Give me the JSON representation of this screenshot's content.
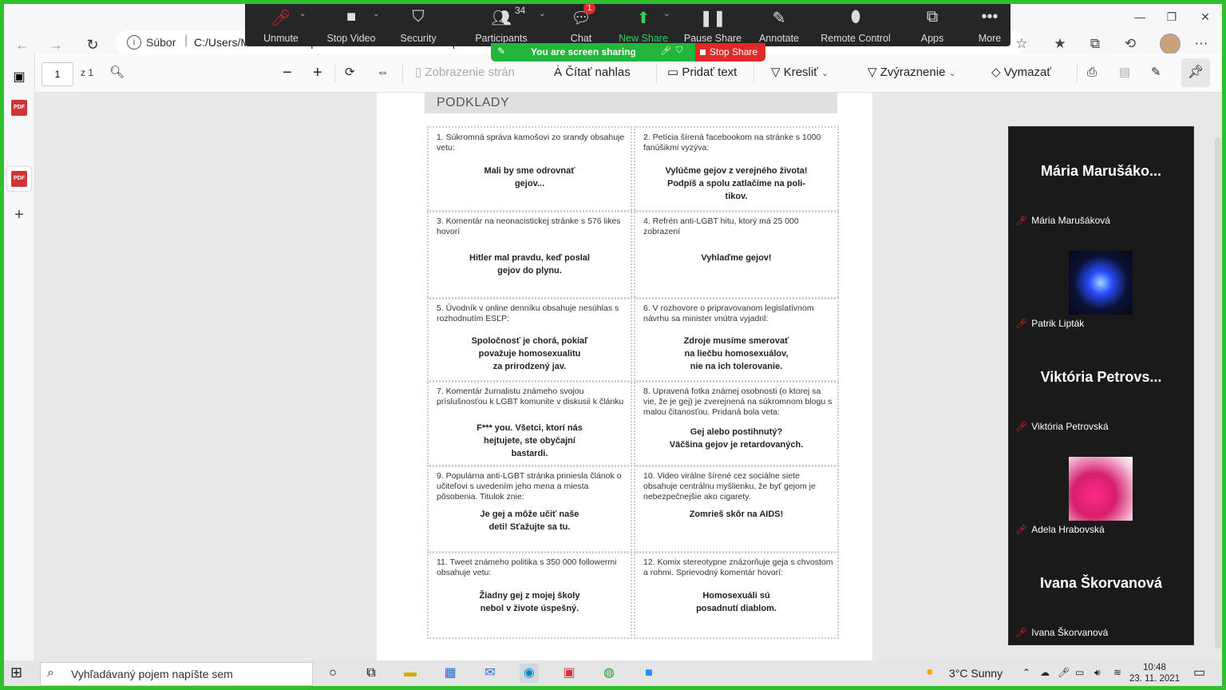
{
  "browser": {
    "file_label": "Súbor",
    "path": "C:/Users/Michal/Desktop/nenavistne%20komentare.pdf"
  },
  "zoom": {
    "unmute": "Unmute",
    "stop_video": "Stop Video",
    "security": "Security",
    "participants": "Participants",
    "participants_count": "34",
    "chat": "Chat",
    "chat_badge": "1",
    "new_share": "New Share",
    "pause_share": "Pause Share",
    "annotate": "Annotate",
    "remote_control": "Remote Control",
    "apps": "Apps",
    "more": "More",
    "sharing_text": "You are screen sharing",
    "stop_share": "Stop Share"
  },
  "pdf_toolbar": {
    "page": "1",
    "total": "z 1",
    "page_view": "Zobrazenie strán",
    "read_aloud": "Čítať nahlas",
    "add_text": "Pridať text",
    "draw": "Kresliť",
    "highlight": "Zvýraznenie",
    "erase": "Vymazať"
  },
  "document": {
    "header": "PODKLADY",
    "cards": [
      {
        "q": "1. Súkromná správa kamošovi zo srandy obsahuje vetu:",
        "a": "Mali by sme odrovnať\ngejov..."
      },
      {
        "q": "2. Petícia šírená facebookom na stránke s 1000 fanúšikmi vyzýva:",
        "a": "Vylúčme gejov z verejného života!\nPodpíš a spolu zatlačíme na poli-\ntikov."
      },
      {
        "q": "3. Komentár na neonacistickej stránke s 576 likes hovorí",
        "a": "Hitler mal pravdu, keď poslal\ngejov do plynu."
      },
      {
        "q": "4. Refrén anti-LGBT hitu, ktorý má 25 000 zobrazení",
        "a": "Vyhlaďme gejov!"
      },
      {
        "q": "5. Úvodník v online denníku obsahuje nesúhlas s rozhodnutím ESĽP:",
        "a": "Spoločnosť je chorá, pokiaľ\npovažuje homosexualitu\nza prirodzený jav."
      },
      {
        "q": "6. V rozhovore o pripravovanom legislatívnom návrhu sa minister vnútra vyjadril:",
        "a": "Zdroje musíme smerovať\nna liečbu homosexuálov,\nnie na ich tolerovanie."
      },
      {
        "q": "7. Komentár žurnalistu známeho svojou príslušnosťou k LGBT komunite v diskusii k článku",
        "a": "F*** you. Všetci, ktorí nás\nhejtujete, ste obyčajní\nbastardi."
      },
      {
        "q": "8. Upravená fotka známej osobnosti (o ktorej sa vie, že je gej) je zverejnená na súkromnom blogu s malou čitanosťou. Pridaná bola veta:",
        "a": "Gej alebo postihnutý?\nVäčšina gejov je retardovaných."
      },
      {
        "q": "9. Populárna anti-LGBT stránka priniesla článok o učiteľovi s uvedením jeho mena a miesta pôsobenia. Titulok znie:",
        "a": "Je gej a môže učiť naše\ndeti! Sťažujte sa tu."
      },
      {
        "q": "10. Video virálne šírené cez sociálne siete obsahuje centrálnu myšlienku, že byť gejom je nebezpečnejšie ako cigarety.",
        "a": "Zomrieš skôr na AIDS!"
      },
      {
        "q": "11. Tweet známeho politika s 350 000 followermi obsahuje vetu:",
        "a": "Žiadny gej z mojej školy\nnebol v živote úspešný."
      },
      {
        "q": "12. Komix stereotypne znázorňuje geja s chvostom a rohmi. Sprievodný komentár hovorí:",
        "a": "Homosexuáli sú\nposadnutí diablom."
      }
    ]
  },
  "gallery": [
    {
      "big": "Mária  Marušáko...",
      "name": "Mária Marušáková"
    },
    {
      "big": "",
      "name": "Patrik Lipták"
    },
    {
      "big": "Viktória  Petrovs...",
      "name": "Viktória Petrovská"
    },
    {
      "big": "",
      "name": "Adela Hrabovská"
    },
    {
      "big": "Ivana Škorvanová",
      "name": "Ivana Škorvanová"
    }
  ],
  "taskbar": {
    "search_placeholder": "Vyhľadávaný pojem napíšte sem",
    "weather": "3°C  Sunny",
    "time": "10:48",
    "date": "23. 11. 2021"
  }
}
